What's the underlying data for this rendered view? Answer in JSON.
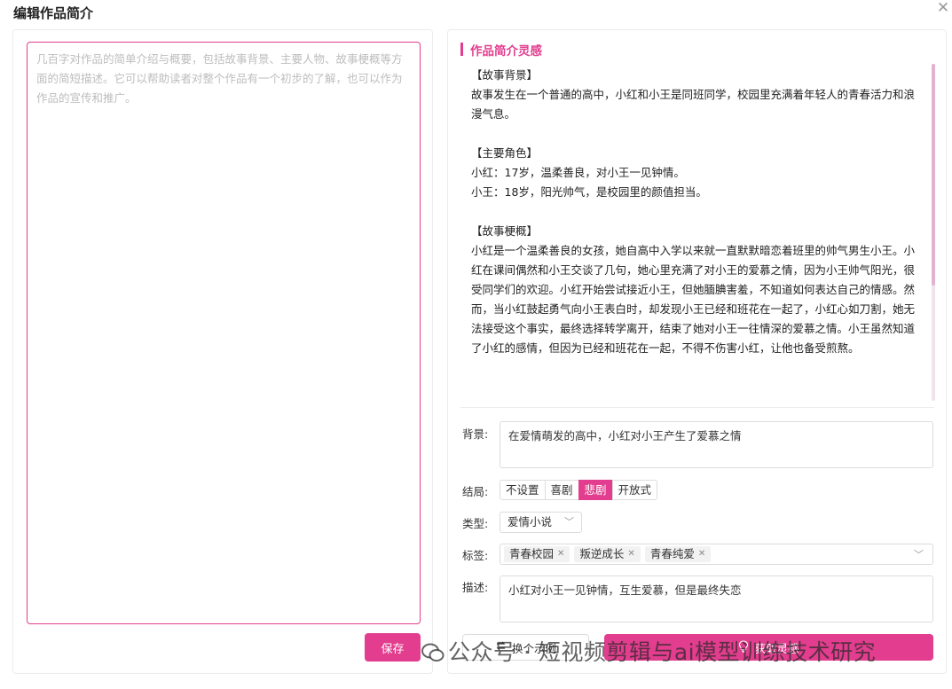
{
  "dialog": {
    "title": "编辑作品简介"
  },
  "editor": {
    "placeholder": "几百字对作品的简单介绍与概要，包括故事背景、主要人物、故事梗概等方面的简短描述。它可以帮助读者对整个作品有一个初步的了解，也可以作为作品的宣传和推广。",
    "save_label": "保存"
  },
  "inspiration": {
    "title": "作品简介灵感",
    "content": [
      "【故事背景】",
      "故事发生在一个普通的高中，小红和小王是同班同学，校园里充满着年轻人的青春活力和浪漫气息。",
      "",
      "【主要角色】",
      "小红：17岁，温柔善良，对小王一见钟情。",
      "小王：18岁，阳光帅气，是校园里的颜值担当。",
      "",
      "【故事梗概】",
      "小红是一个温柔善良的女孩，她自高中入学以来就一直默默暗恋着班里的帅气男生小王。小红在课间偶然和小王交谈了几句，她心里充满了对小王的爱慕之情，因为小王帅气阳光，很受同学们的欢迎。小红开始尝试接近小王，但她腼腆害羞，不知道如何表达自己的情感。然而，当小红鼓起勇气向小王表白时，却发现小王已经和班花在一起了，小红心如刀割，她无法接受这个事实，最终选择转学离开，结束了她对小王一往情深的爱慕之情。小王虽然知道了小红的感情，但因为已经和班花在一起，不得不伤害小红，让他也备受煎熬。"
    ]
  },
  "form": {
    "background": {
      "label": "背景:",
      "value": "在爱情萌发的高中，小红对小王产生了爱慕之情"
    },
    "ending": {
      "label": "结局:",
      "options": [
        "不设置",
        "喜剧",
        "悲剧",
        "开放式"
      ],
      "selected": "悲剧"
    },
    "type": {
      "label": "类型:",
      "value": "爱情小说"
    },
    "tags": {
      "label": "标签:",
      "items": [
        "青春校园",
        "叛逆成长",
        "青春纯爱"
      ]
    },
    "description": {
      "label": "描述:",
      "value": "小红对小王一见钟情，互生爱慕，但是最终失恋"
    }
  },
  "actions": {
    "swap_example_label": "换个示例",
    "get_inspiration_label": "获取灵感"
  },
  "watermark": {
    "text": "公众号 · 短视频剪辑与ai模型训练技术研究"
  },
  "icons": {
    "close": "close-icon",
    "chevron": "chevron-down-icon",
    "tag_close": "tag-close-icon",
    "swap": "swap-icon",
    "bulb": "lightbulb-icon",
    "wechat": "wechat-icon"
  },
  "colors": {
    "accent": "#e23d8e"
  }
}
